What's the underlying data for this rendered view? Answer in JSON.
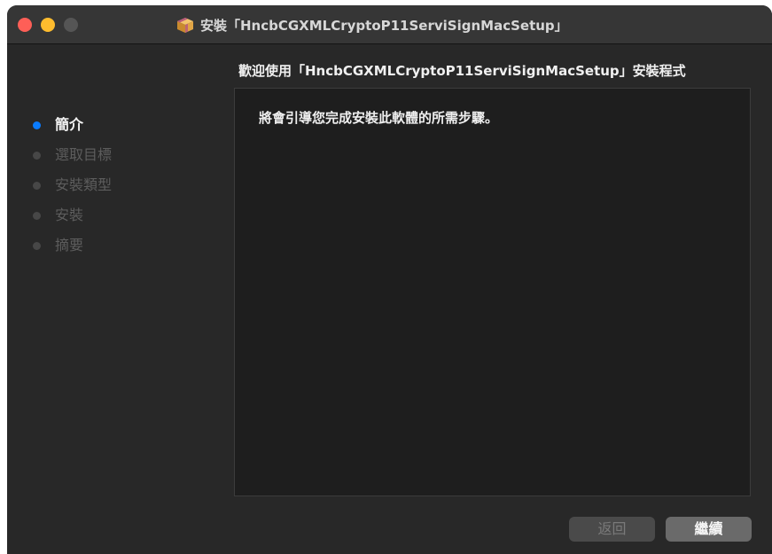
{
  "window": {
    "title": "安裝「HncbCGXMLCryptoP11ServiSignMacSetup」",
    "icon": "package-icon"
  },
  "heading": "歡迎使用「HncbCGXMLCryptoP11ServiSignMacSetup」安裝程式",
  "sidebar": {
    "steps": [
      {
        "label": "簡介",
        "state": "active"
      },
      {
        "label": "選取目標",
        "state": "inactive"
      },
      {
        "label": "安裝類型",
        "state": "inactive"
      },
      {
        "label": "安裝",
        "state": "inactive"
      },
      {
        "label": "摘要",
        "state": "inactive"
      }
    ]
  },
  "content": {
    "intro_text": "將會引導您完成安裝此軟體的所需步驟。"
  },
  "buttons": {
    "back_label": "返回",
    "back_enabled": false,
    "continue_label": "繼續",
    "continue_enabled": true
  },
  "colors": {
    "window_bg": "#282828",
    "titlebar_bg": "#363636",
    "panel_bg": "#1e1e1e",
    "active_step_dot": "#0a7cff",
    "close": "#fe5f57",
    "minimize": "#febc2e"
  }
}
